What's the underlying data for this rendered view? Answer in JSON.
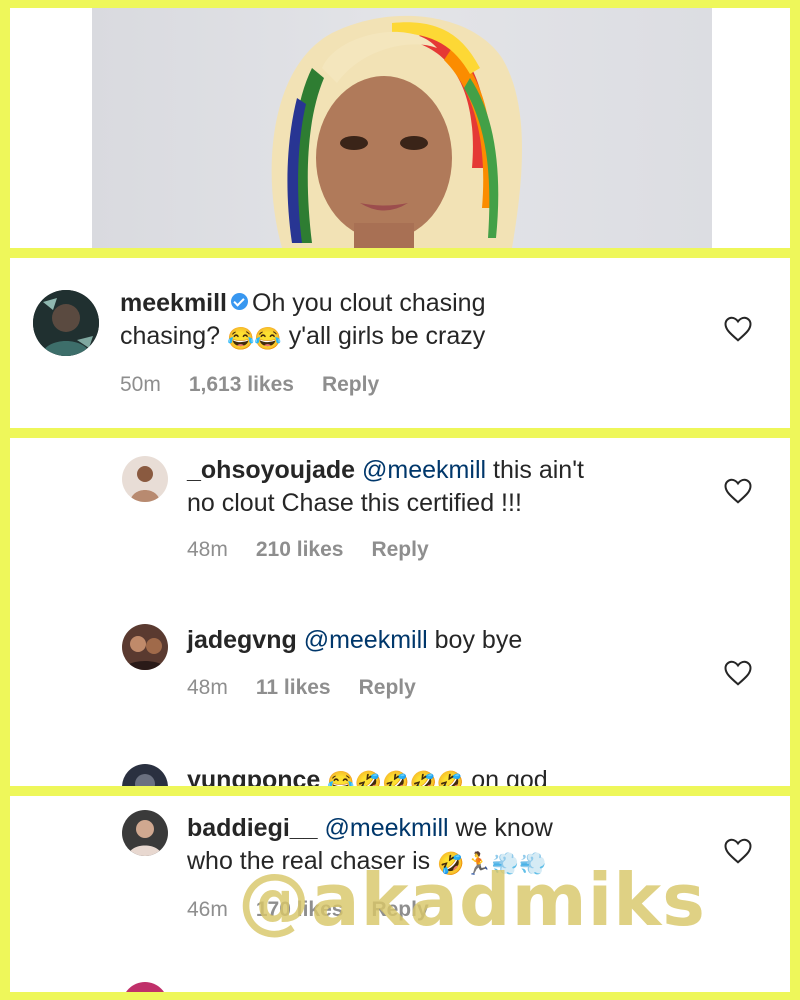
{
  "comments": [
    {
      "username": "meekmill",
      "text_part1": "Oh you clout chasing",
      "text_part2_pre": "chasing?",
      "emojis": "😂😂",
      "text_part2_post": "y'all girls be crazy",
      "time": "50m",
      "likes": "1,613 likes",
      "reply": "Reply"
    },
    {
      "username": "_ohsoyoujade",
      "mention": "@meekmill",
      "text_line1": "this ain't",
      "text_line2": "no clout Chase this certified !!!",
      "time": "48m",
      "likes": "210 likes",
      "reply": "Reply"
    },
    {
      "username": "jadegvng",
      "mention": "@meekmill",
      "text": "boy bye",
      "time": "48m",
      "likes": "11 likes",
      "reply": "Reply"
    },
    {
      "username": "yungponce",
      "emojis": "😂🤣🤣🤣🤣",
      "text": "on god"
    },
    {
      "username": "baddiegi__",
      "mention": "@meekmill",
      "text_line1": "we know",
      "text_line2": "who the real chaser is",
      "emojis": "🤣🏃💨💨",
      "time": "46m",
      "likes": "170 likes",
      "reply": "Reply"
    }
  ],
  "watermark": "@akadmiks",
  "colors": {
    "border": "#eef75a",
    "text": "#262626",
    "meta": "#8e8e8e",
    "verified": "#3897f0"
  }
}
